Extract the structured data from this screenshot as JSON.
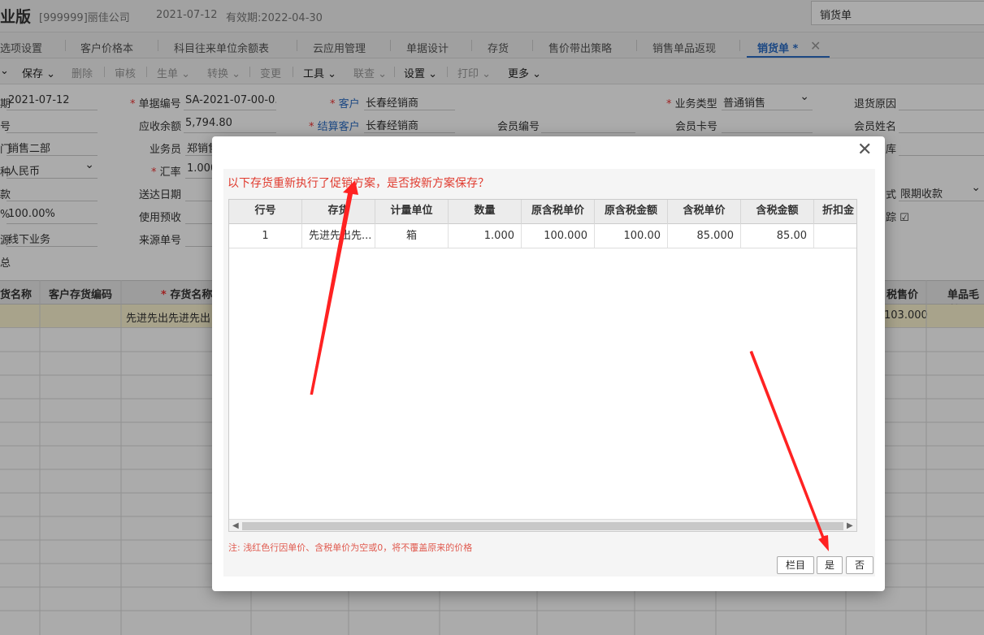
{
  "header": {
    "app_title": "业版",
    "company": "[999999]丽佳公司",
    "date": "2021-07-12",
    "expiry": "有效期:2022-04-30",
    "search_value": "销货单"
  },
  "tabs": [
    {
      "label": "选项设置"
    },
    {
      "label": "客户价格本"
    },
    {
      "label": "科目往来单位余额表"
    },
    {
      "label": "云应用管理"
    },
    {
      "label": "单据设计"
    },
    {
      "label": "存货"
    },
    {
      "label": "售价带出策略"
    },
    {
      "label": "销售单品返现"
    },
    {
      "label": "销货单 *"
    }
  ],
  "toolbar": {
    "save": "保存",
    "delete": "删除",
    "audit": "审核",
    "generate": "生单",
    "convert": "转换",
    "change": "变更",
    "tools": "工具",
    "query": "联查",
    "settings": "设置",
    "print": "打印",
    "more": "更多"
  },
  "form": {
    "date_label": "期",
    "date_value": "2021-07-12",
    "order_no_label": "单据编号",
    "order_no_value": "SA-2021-07-00-0...",
    "customer_label": "客户",
    "customer_value": "长春经销商",
    "biz_type_label": "业务类型",
    "biz_type_value": "普通销售",
    "return_reason_label": "退货原因",
    "row2_label": "号",
    "receivable_label": "应收余额",
    "receivable_value": "5,794.80",
    "settle_customer_label": "结算客户",
    "settle_customer_value": "长春经销商",
    "member_no_label": "会员编号",
    "member_card_label": "会员卡号",
    "member_name_label": "会员姓名",
    "dept_label": "门",
    "dept_value": "销售二部",
    "salesman_label": "业务员",
    "salesman_value": "郑销售",
    "warehouse_label": "库",
    "currency_label": "种",
    "currency_value": "人民币",
    "rate_label": "汇率",
    "rate_value": "1.000",
    "row5_label": "款",
    "delivery_date_label": "送达日期",
    "payment_method_label": "式",
    "payment_method_value": "限期收款",
    "row6_label": "%",
    "row6_value": "100.00%",
    "use_prepay_label": "使用预收",
    "track_label": "踪",
    "row7_label": "源",
    "row7_value": "线下业务",
    "source_no_label": "来源单号",
    "row8_label": "总"
  },
  "grid": {
    "headers": {
      "item_name": "货名称",
      "cust_item_code": "客户存货编码",
      "item_name2": "存货名称",
      "tax_price": "税售价",
      "gross_margin": "单品毛利"
    },
    "row1": {
      "item": "先进先出先进先出",
      "tax_price": "103.000"
    }
  },
  "dialog": {
    "message": "以下存货重新执行了促销方案，是否按新方案保存？",
    "columns": [
      "行号",
      "存货",
      "计量单位",
      "数量",
      "原含税单价",
      "原含税金额",
      "含税单价",
      "含税金额",
      "折扣金"
    ],
    "rows": [
      {
        "line": "1",
        "item": "先进先出先...",
        "unit": "箱",
        "qty": "1.000",
        "orig_price": "100.000",
        "orig_amount": "100.00",
        "price": "85.000",
        "amount": "85.00",
        "discount": ""
      }
    ],
    "note": "注: 浅红色行因单价、含税单价为空或0，将不覆盖原来的价格",
    "btn_columns": "栏目",
    "btn_yes": "是",
    "btn_no": "否"
  }
}
